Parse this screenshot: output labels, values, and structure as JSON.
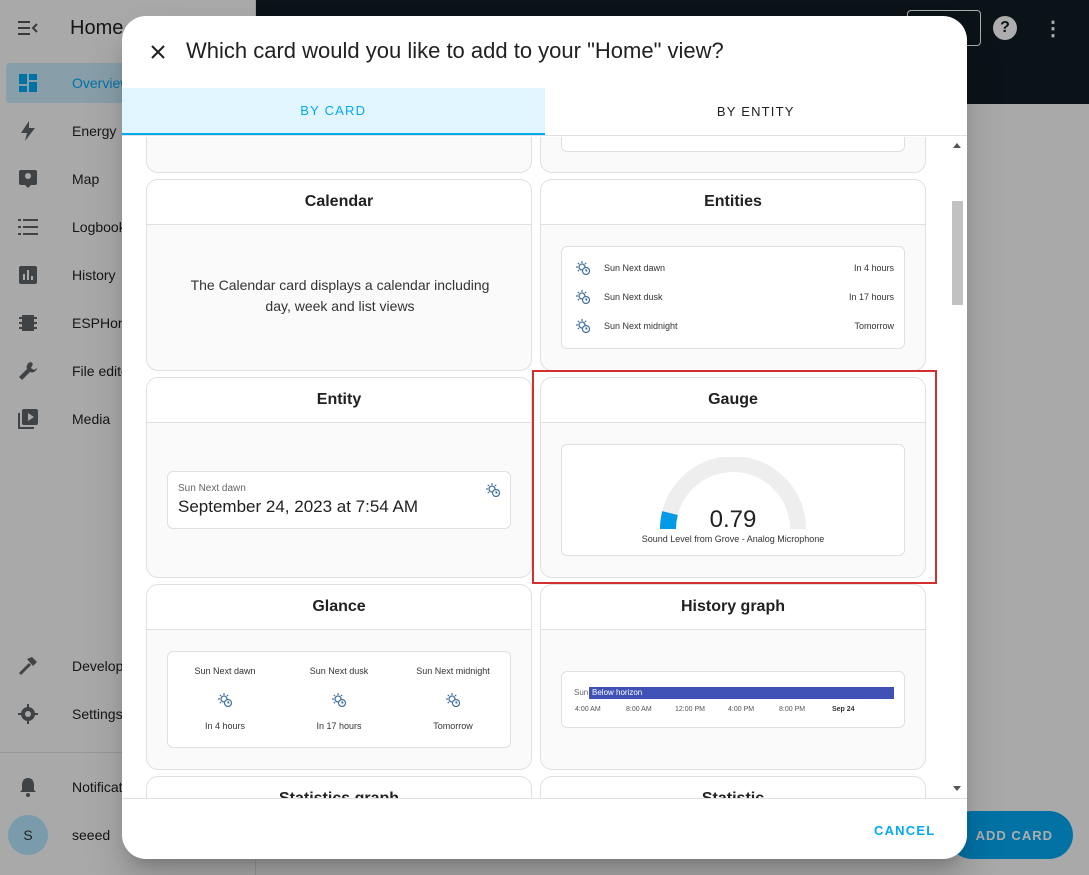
{
  "sidebar": {
    "title": "Home",
    "items": [
      {
        "label": "Overview",
        "icon": "dashboard-icon"
      },
      {
        "label": "Energy",
        "icon": "lightning-icon"
      },
      {
        "label": "Map",
        "icon": "map-icon"
      },
      {
        "label": "Logbook",
        "icon": "list-icon"
      },
      {
        "label": "History",
        "icon": "chart-icon"
      },
      {
        "label": "ESPHome",
        "icon": "chip-icon"
      },
      {
        "label": "File editor",
        "icon": "wrench-icon"
      },
      {
        "label": "Media",
        "icon": "media-icon"
      }
    ],
    "bottom": [
      {
        "label": "Developer tools",
        "icon": "hammer-icon"
      },
      {
        "label": "Settings",
        "icon": "gear-icon"
      },
      {
        "label": "Notifications",
        "icon": "bell-icon"
      }
    ],
    "user": {
      "name": "seeed",
      "initial": "S"
    }
  },
  "fab": {
    "label": "ADD CARD"
  },
  "dialog": {
    "title": "Which card would you like to add to your \"Home\" view?",
    "tabs": [
      "BY CARD",
      "BY ENTITY"
    ],
    "cancel": "CANCEL"
  },
  "cards": {
    "calendar": {
      "title": "Calendar",
      "description": "The Calendar card displays a calendar including day, week and list views"
    },
    "entities": {
      "title": "Entities",
      "rows": [
        {
          "name": "Sun Next dawn",
          "value": "In 4 hours"
        },
        {
          "name": "Sun Next dusk",
          "value": "In 17 hours"
        },
        {
          "name": "Sun Next midnight",
          "value": "Tomorrow"
        }
      ]
    },
    "entity": {
      "title": "Entity",
      "label": "Sun Next dawn",
      "value": "September 24, 2023 at 7:54 AM"
    },
    "gauge": {
      "title": "Gauge",
      "value": "0.79",
      "level": 0.079,
      "name": "Sound Level from Grove - Analog Microphone"
    },
    "glance": {
      "title": "Glance",
      "items": [
        {
          "name": "Sun Next dawn",
          "state": "In 4 hours"
        },
        {
          "name": "Sun Next dusk",
          "state": "In 17 hours"
        },
        {
          "name": "Sun Next midnight",
          "state": "Tomorrow"
        }
      ]
    },
    "history": {
      "title": "History graph",
      "entity": "Sun",
      "bar_label": "Below horizon",
      "bar_color": "#3f51b5",
      "ticks": [
        "4:00 AM",
        "8:00 AM",
        "12:00 PM",
        "4:00 PM",
        "8:00 PM",
        "Sep 24"
      ]
    },
    "statistics_graph": {
      "title": "Statistics graph"
    },
    "statistic": {
      "title": "Statistic"
    }
  },
  "colors": {
    "accent": "#03a9f4",
    "highlight": "#d32f2f",
    "topbar": "#101e24"
  }
}
